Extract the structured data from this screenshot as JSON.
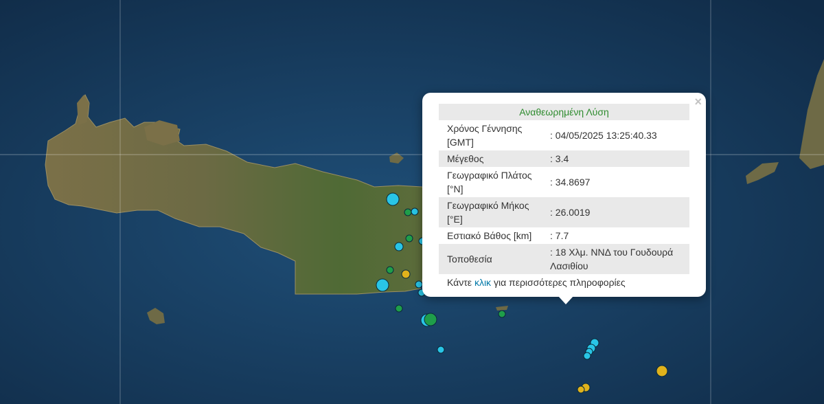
{
  "popup": {
    "header": "Αναθεωρημένη Λύση",
    "close_glyph": "×",
    "rows": [
      {
        "label": "Χρόνος Γέννησης [GMT]",
        "value": ": 04/05/2025 13:25:40.33"
      },
      {
        "label": "Μέγεθος",
        "value": ": 3.4"
      },
      {
        "label": "Γεωγραφικό Πλάτος [°N]",
        "value": ": 34.8697"
      },
      {
        "label": "Γεωγραφικό Μήκος [°E]",
        "value": ": 26.0019"
      },
      {
        "label": "Εστιακό Βάθος [km]",
        "value": ": 7.7"
      },
      {
        "label": "Τοποθεσία",
        "value": ": 18 Χλμ. ΝΝΔ του Γουδουρά Λασιθίου"
      }
    ],
    "footer_prefix": "Κάντε",
    "footer_link": "κλικ",
    "footer_suffix": "για περισσότερες πληροφορίες"
  },
  "map": {
    "colors": {
      "sea_deep": "#12304f",
      "sea_shallow": "#1f4f78",
      "land": "#6b6a45",
      "land_green": "#4f6a35",
      "land_light": "#8a7a55",
      "graticule": "#ffffff",
      "marker_cyan": "#29c5e6",
      "marker_green": "#1f9e4a",
      "marker_yellow": "#e0b21c"
    }
  }
}
